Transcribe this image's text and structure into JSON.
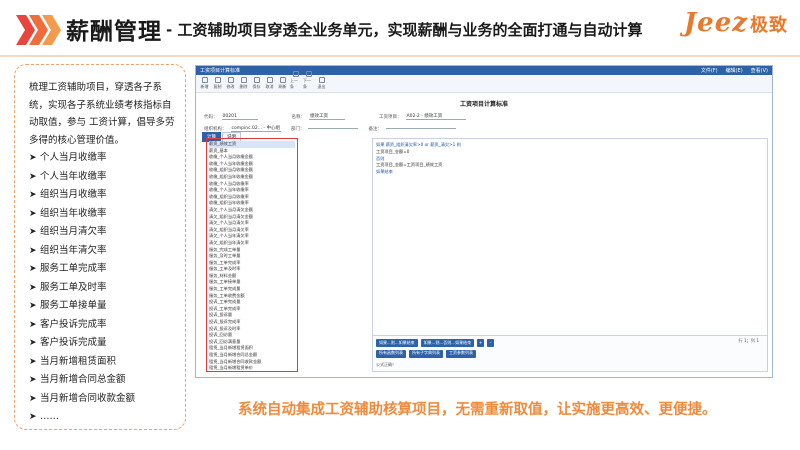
{
  "header": {
    "title_main": "薪酬管理",
    "title_sub": "- 工资辅助项目穿透全业务单元，实现薪酬与业务的全面打通与自动计算",
    "logo_en": "Jeez",
    "logo_cn": "极致"
  },
  "left_panel": {
    "intro": "梳理工资辅助项目，穿透各子系统，实现各子系统业绩考核指标自动取值，参与 工资计算，倡导多劳多得的核心管理价值。",
    "items": [
      "个人当月收缴率",
      "个人当年收缴率",
      "组织当月收缴率",
      "组织当年收缴率",
      "组织当月清欠率",
      "组织当年清欠率",
      "服务工单完成率",
      "服务工单及时率",
      "服务工单接单量",
      "客户投诉完成率",
      "客户投诉完成量",
      "当月新增租赁面积",
      "当月新增合同总金额",
      "当月新增合同收款金额",
      "……"
    ]
  },
  "app": {
    "window_title": "工资项目计算标准",
    "title_right": [
      "文件(F)",
      "编辑(E)",
      "查看(V)"
    ],
    "toolbar": [
      "新增",
      "复制",
      "修改",
      "删除",
      "保存",
      "取消",
      "刷新",
      "上一条",
      "下一条",
      "退出"
    ],
    "form_title": "工资项目计算标准",
    "row1": {
      "l1": "代码：",
      "v1": "00201",
      "l2": "名称：",
      "v2": "绩效工资",
      "l3": "工资项目：",
      "v3": "A02-2 - 绩效工资"
    },
    "row2": {
      "l1": "组织机构：",
      "v1": "compinc.02... - 中心组",
      "l2": "部门：",
      "v2": "",
      "l3": "备注：",
      "v3": ""
    },
    "tabs": [
      "计算",
      "说明"
    ],
    "list_items": [
      "薪资_绩效工资",
      "薪资_基本",
      "收缴_个人当月收缴金额",
      "收缴_个人当年收缴金额",
      "收缴_组织当月收缴金额",
      "收缴_组织当年收缴金额",
      "收缴_个人当月收缴率",
      "收缴_个人当年收缴率",
      "收缴_组织当月收缴率",
      "收缴_组织当年收缴率",
      "清欠_个人当月清欠金额",
      "清欠_组织当月清欠金额",
      "清欠_个人当月清欠率",
      "清欠_组织当月清欠率",
      "清欠_个人当年清欠率",
      "清欠_组织当年清欠率",
      "服务_完成工单量",
      "服务_及时工单量",
      "服务_工单完成率",
      "服务_工单及时率",
      "服务_材料金额",
      "服务_工单接单量",
      "服务_工单完成量",
      "服务_工单收费金额",
      "投诉_工单完成量",
      "投诉_工单完成率",
      "投诉_投诉量",
      "投诉_投诉完成率",
      "投诉_投诉及时率",
      "投诉_回访量",
      "投诉_回访满意量",
      "租赁_当月新增租赁面积",
      "租赁_当月新增合同总金额",
      "租赁_当月新增合同收款金额",
      "租赁_当月新增租赁单价"
    ],
    "editor_lines": [
      "如果 薪资_组织清欠率>0 or 薪资_清欠>1 则",
      "工资项目_金额=0",
      "否则",
      "工资项目_金额=工资项目_绩效工资",
      "如果结束"
    ],
    "foot_buttons": [
      "如果...则...如果结束",
      "如果...则...否则...如果结束",
      "+",
      "-",
      "所有函数列表",
      "所有子字典列表",
      "工资参数列表"
    ],
    "rowcount": "行 1；列 1",
    "formula_label": "公式正确！"
  },
  "footer_note": "系统自动集成工资辅助核算项目，无需重新取值，让实施更高效、更便捷。"
}
